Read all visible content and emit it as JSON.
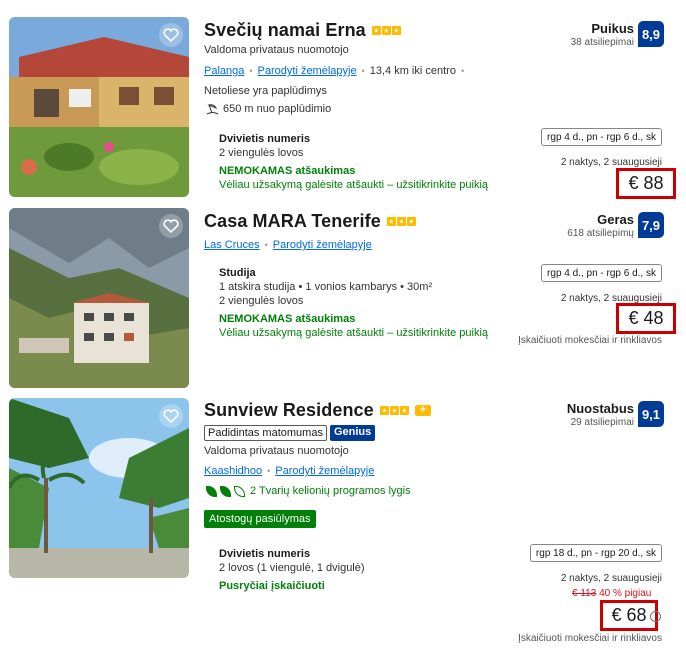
{
  "listings": [
    {
      "name": "Svečių namai Erna",
      "stars": 3,
      "managed_by": "Valdoma privataus nuomotojo",
      "location": "Palanga",
      "map_link": "Parodyti žemėlapyje",
      "distance": "13,4 km iki centro",
      "nearby": "Netoliese yra paplūdimys",
      "beach_distance": "650 m nuo paplūdimio",
      "rating_word": "Puikus",
      "rating_count": "38 atsiliepimai",
      "score": "8,9",
      "room_name": "Dvivietis numeris",
      "room_details": [
        "2 viengulės lovos"
      ],
      "free_cancel": "NEMOKAMAS atšaukimas",
      "cancel_note": "Vėliau užsakymą galėsite atšaukti – užsitikrinkite puikią",
      "dates": "rgp 4 d., pn - rgp 6 d., sk",
      "nights": "2 naktys, 2 suaugusieji",
      "price": "€ 88"
    },
    {
      "name": "Casa MARA Tenerife",
      "stars": 3,
      "location": "Las Cruces",
      "map_link": "Parodyti žemėlapyje",
      "rating_word": "Geras",
      "rating_count": "618 atsiliepimų",
      "score": "7,9",
      "room_name": "Studija",
      "room_details": [
        "1 atskira studija • 1 vonios kambarys • 30m²",
        "2 viengulės lovos"
      ],
      "free_cancel": "NEMOKAMAS atšaukimas",
      "cancel_note": "Vėliau užsakymą galėsite atšaukti – užsitikrinkite puikią",
      "dates": "rgp 4 d., pn - rgp 6 d., sk",
      "nights": "2 naktys, 2 suaugusieji",
      "price": "€ 48",
      "taxes": "Įskaičiuoti mokesčiai ir rinkliavos"
    },
    {
      "name": "Sunview Residence",
      "stars": 3,
      "plus_badge": "+",
      "visibility_chip": "Padidintas matomumas",
      "genius": "Genius",
      "managed_by": "Valdoma privataus nuomotojo",
      "location": "Kaashidhoo",
      "map_link": "Parodyti žemėlapyje",
      "eco_level": "2 Tvarių kelionių programos lygis",
      "deal": "Atostogų pasiūlymas",
      "rating_word": "Nuostabus",
      "rating_count": "29 atsiliepimai",
      "score": "9,1",
      "room_name": "Dvivietis numeris",
      "room_details": [
        "2 lovos (1 viengulė, 1 dvigulė)"
      ],
      "breakfast": "Pusryčiai įskaičiuoti",
      "dates": "rgp 18 d., pn - rgp 20 d., sk",
      "nights": "2 naktys, 2 suaugusieji",
      "old_price": "€ 113",
      "discount": "40 % pigiau",
      "price": "€ 68",
      "taxes": "Įskaičiuoti mokesčiai ir rinkliavos"
    }
  ],
  "colors": {
    "brand_blue": "#003b95",
    "link_blue": "#006ce4",
    "green": "#008009",
    "highlight_red": "#cc0000",
    "star_yellow": "#febb02"
  }
}
